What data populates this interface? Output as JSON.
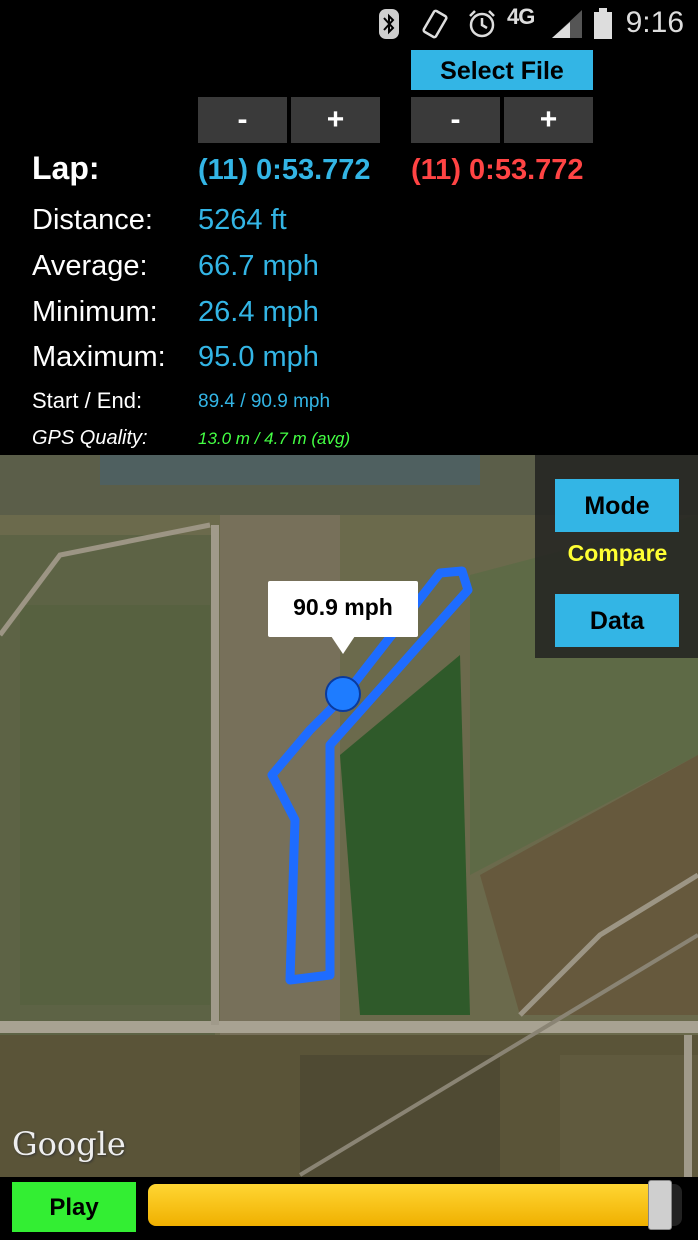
{
  "status_bar": {
    "time": "9:16",
    "network": "4G",
    "icons": [
      "bluetooth-icon",
      "vibrate-icon",
      "alarm-icon",
      "network-4g-icon",
      "signal-icon",
      "battery-icon"
    ]
  },
  "controls": {
    "select_file_label": "Select File",
    "minus_label": "-",
    "plus_label": "+"
  },
  "stats": {
    "lap_label": "Lap:",
    "lap_primary": "(11) 0:53.772",
    "lap_compare": "(11) 0:53.772",
    "distance_label": "Distance:",
    "distance_value": "5264 ft",
    "average_label": "Average:",
    "average_value": "66.7 mph",
    "minimum_label": "Minimum:",
    "minimum_value": "26.4 mph",
    "maximum_label": "Maximum:",
    "maximum_value": "95.0 mph",
    "start_end_label": "Start / End:",
    "start_end_value": "89.4 / 90.9 mph",
    "gps_label": "GPS Quality:",
    "gps_value": "13.0 m / 4.7 m (avg)"
  },
  "map": {
    "speed_bubble": "90.9 mph",
    "mode_label": "Mode",
    "mode_state": "Compare",
    "data_label": "Data",
    "attribution": "Google"
  },
  "playback": {
    "play_label": "Play",
    "progress": 0.98
  },
  "colors": {
    "accent": "#33b5e5",
    "compare": "#ff4444",
    "gps": "#44ff44",
    "mode_state": "#ffff33",
    "play": "#33ee33",
    "slider": "#f0b000"
  }
}
